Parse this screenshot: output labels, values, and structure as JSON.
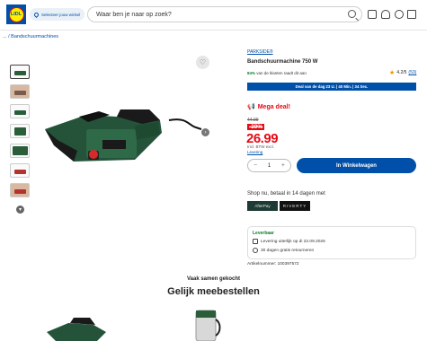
{
  "header": {
    "logo_text": "LIDL",
    "store_label": "Selecteer jouw winkel",
    "search_placeholder": "Waar ben je naar op zoek?"
  },
  "breadcrumb": "... / Bandschuurmachines",
  "product": {
    "brand": "PARKSIDE®",
    "title": "Bandschuurmachine 750 W",
    "recommend_pct": "84%",
    "recommend_text": "van de klanten raadt dit aan",
    "rating": "4.2/5",
    "rating_count": "(53)",
    "deal_bar": "Deal van de dag  23 U. | 40 Min. | 34 Sec.",
    "mega_deal": "Mega deal!",
    "old_price": "44.99",
    "discount": "-39%",
    "price": "26.99",
    "vat": "Incl. BTW excl.",
    "levering_link": "Levering",
    "qty": "1",
    "add_to_cart": "In Winkelwagen",
    "pay_later": "Shop nu, betaal in 14 dagen met",
    "pay_1": "AfterPay",
    "pay_2": "RIVERTY",
    "availability": "Leverbaar",
    "delivery_text": "Levering uiterlijk op di 22.09.2026",
    "return_text": "30 dagen gratis retourneren",
    "article_number": "Artikelnummer: 100397572"
  },
  "related": {
    "subtitle": "Vaak samen gekocht",
    "title": "Gelijk meebestellen"
  },
  "colors": {
    "brand_blue": "#0050aa",
    "sale_red": "#e60a14",
    "lidl_yellow": "#fff000"
  }
}
